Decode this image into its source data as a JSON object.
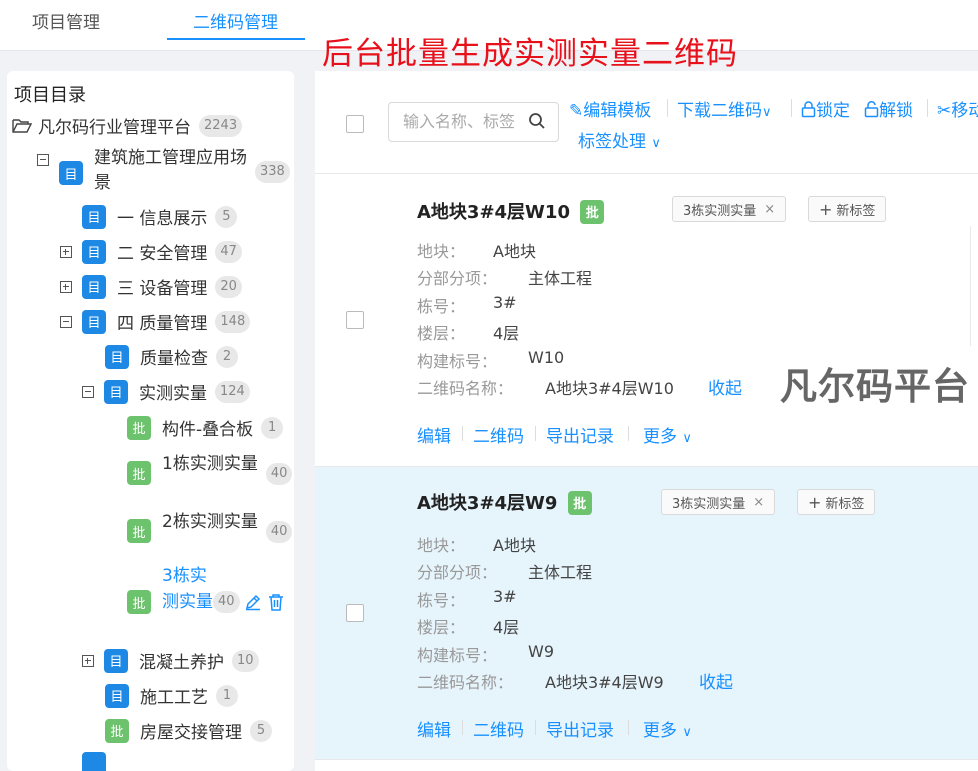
{
  "tabs": [
    "项目管理",
    "二维码管理"
  ],
  "banner": "后台批量生成实测实量二维码",
  "sidebar": {
    "title": "项目目录",
    "root": {
      "label": "凡尔码行业管理平台",
      "count": "2243"
    },
    "items": [
      {
        "label": "建筑施工管理应用场",
        "label2": "景",
        "count": "338",
        "badge": "目"
      },
      {
        "label": "一 信息展示",
        "count": "5",
        "badge": "目"
      },
      {
        "label": "二 安全管理",
        "count": "47",
        "badge": "目"
      },
      {
        "label": "三 设备管理",
        "count": "20",
        "badge": "目"
      },
      {
        "label": "四 质量管理",
        "count": "148",
        "badge": "目"
      },
      {
        "label": "质量检查",
        "count": "2",
        "badge": "目"
      },
      {
        "label": "实测实量",
        "count": "124",
        "badge": "目"
      },
      {
        "label": "构件-叠合板",
        "count": "1",
        "badge": "批"
      },
      {
        "label": "1栋实测实量",
        "count": "40",
        "badge": "批"
      },
      {
        "label": "2栋实测实量",
        "count": "40",
        "badge": "批"
      },
      {
        "label": "3栋实",
        "label2": "测实量",
        "count": "40",
        "badge": "批"
      },
      {
        "label": "混凝土养护",
        "count": "10",
        "badge": "目"
      },
      {
        "label": "施工工艺",
        "count": "1",
        "badge": "目"
      },
      {
        "label": "房屋交接管理",
        "count": "5",
        "badge": "批"
      }
    ]
  },
  "toolbar": {
    "search_placeholder": "输入名称、标签",
    "edit_template": "编辑模板",
    "download_qr": "下载二维码",
    "lock": "锁定",
    "unlock": "解锁",
    "move": "移动",
    "tag_process": "标签处理"
  },
  "card_labels": {
    "plot": "地块：",
    "division": "分部分项：",
    "building": "栋号：",
    "floor": "楼层：",
    "component": "构建标号：",
    "qr_name": "二维码名称：",
    "collapse": "收起",
    "edit": "编辑",
    "qr": "二维码",
    "export": "导出记录",
    "more": "更多",
    "new_tag": "新标签",
    "batch_badge": "批"
  },
  "cards": [
    {
      "title": "A地块3#4层W10",
      "tag": "3栋实测实量",
      "plot": "A地块",
      "division": "主体工程",
      "building": "3#",
      "floor": "4层",
      "component": "W10",
      "qr_name": "A地块3#4层W10"
    },
    {
      "title": "A地块3#4层W9",
      "tag": "3栋实测实量",
      "plot": "A地块",
      "division": "主体工程",
      "building": "3#",
      "floor": "4层",
      "component": "W9",
      "qr_name": "A地块3#4层W9"
    }
  ],
  "watermark": "凡尔码平台",
  "colors": {
    "accent": "#1890ff",
    "banner": "#e8101a",
    "badge_blue": "#1e88e5",
    "badge_green": "#6dc36d",
    "selected_bg": "#e6f4fc"
  }
}
